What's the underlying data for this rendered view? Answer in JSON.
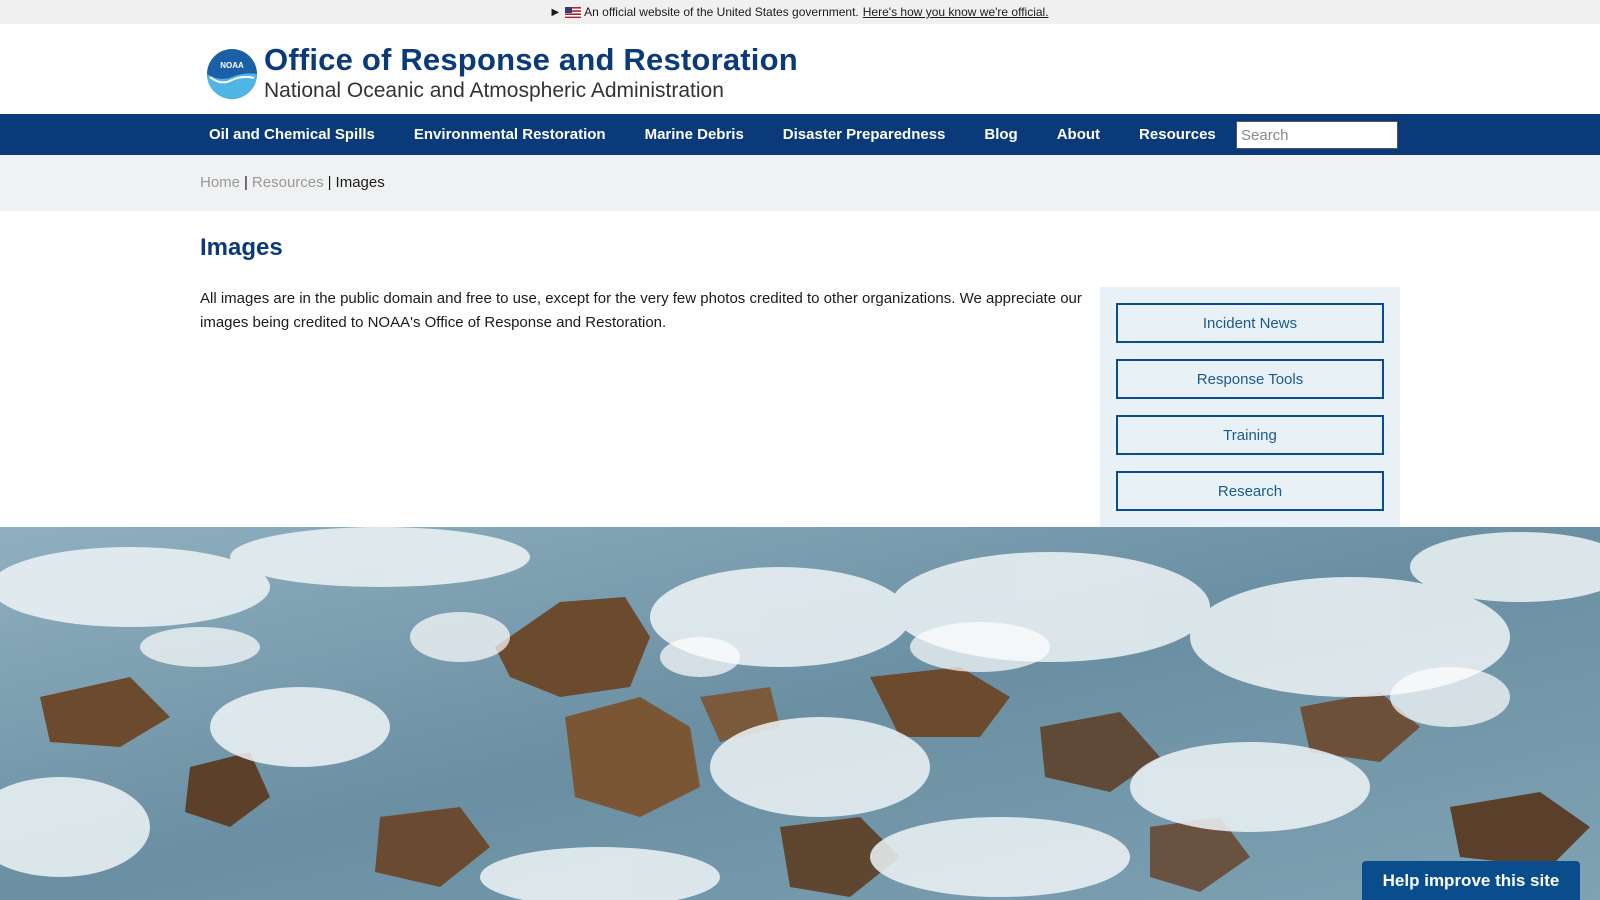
{
  "gov_banner": {
    "text": "An official website of the United States government.",
    "link": "Here's how you know we're official."
  },
  "header": {
    "logo_text": "NOAA",
    "title": "Office of Response and Restoration",
    "subtitle": "National Oceanic and Atmospheric Administration"
  },
  "nav": {
    "items": [
      {
        "label": "Oil and Chemical Spills"
      },
      {
        "label": "Environmental Restoration"
      },
      {
        "label": "Marine Debris"
      },
      {
        "label": "Disaster Preparedness"
      },
      {
        "label": "Blog"
      },
      {
        "label": "About"
      },
      {
        "label": "Resources"
      }
    ],
    "search_placeholder": "Search"
  },
  "breadcrumb": {
    "items": [
      "Home",
      "Resources",
      "Images"
    ],
    "separator": "|"
  },
  "main": {
    "title": "Images",
    "intro": "All images are in the public domain and free to use, except for the very few photos credited to other organizations. We appreciate our images being credited to NOAA's Office of Response and Restoration."
  },
  "sidebar": {
    "buttons": [
      {
        "label": "Incident News"
      },
      {
        "label": "Response Tools"
      },
      {
        "label": "Training"
      },
      {
        "label": "Research"
      }
    ]
  },
  "feedback": {
    "label": "Help improve this site"
  },
  "colors": {
    "brand_navy": "#0a3a7a",
    "sidebar_bg": "#e8f1f6",
    "feedback_blue": "#0a4d8c"
  }
}
